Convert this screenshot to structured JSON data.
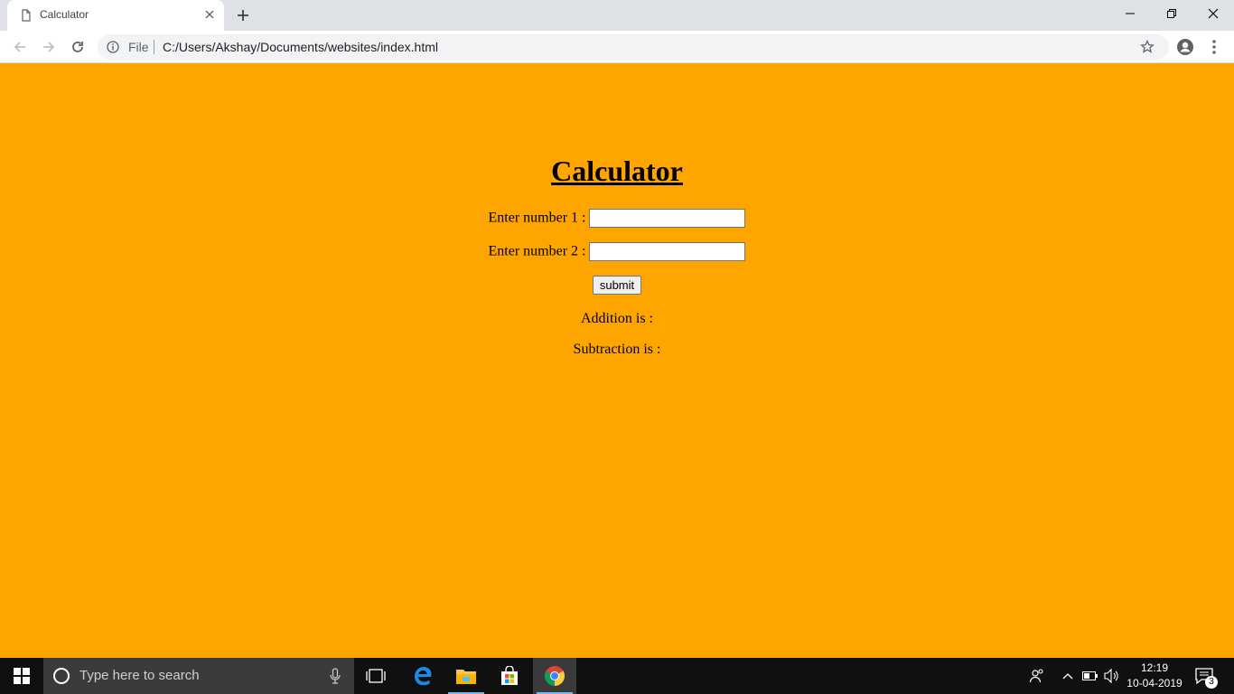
{
  "browser": {
    "tab_title": "Calculator",
    "address": {
      "scheme_label": "File",
      "url": "C:/Users/Akshay/Documents/websites/index.html"
    }
  },
  "page": {
    "heading": "Calculator",
    "number1_label": "Enter number 1 :",
    "number1_value": "",
    "number2_label": "Enter number 2 :",
    "number2_value": "",
    "submit_label": "submit",
    "addition_label": "Addition is :",
    "subtraction_label": "Subtraction is :",
    "background_color": "#ffa500"
  },
  "taskbar": {
    "search_placeholder": "Type here to search",
    "pinned_icons": [
      "task-view-icon",
      "edge-icon",
      "file-explorer-icon",
      "store-icon",
      "chrome-icon"
    ],
    "time": "12:19",
    "date": "10-04-2019",
    "notification_count": "3"
  }
}
